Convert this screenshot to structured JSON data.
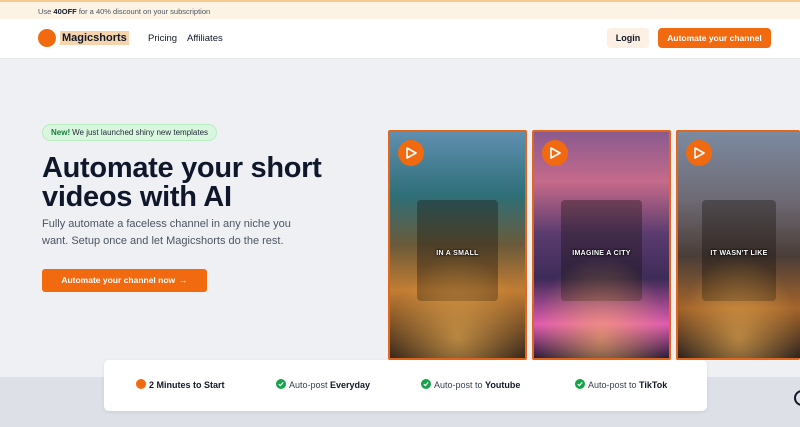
{
  "promo": {
    "prefix": "Use ",
    "code": "40OFF",
    "suffix": " for a 40% discount on your subscription"
  },
  "nav": {
    "brand": "Magicshorts",
    "links": [
      "Pricing",
      "Affiliates"
    ],
    "login": "Login",
    "cta": "Automate your channel"
  },
  "hero": {
    "badge_strong": "New!",
    "badge_text": "We just launched shiny new templates",
    "title": "Automate your short videos with AI",
    "subtitle": "Fully automate a faceless channel in any niche you want. Setup once and let Magicshorts do the rest.",
    "cta": "Automate your channel now",
    "cta_icon": "arrow-right-icon"
  },
  "videos": [
    {
      "caption": "IN A SMALL",
      "icon": "play-icon"
    },
    {
      "caption": "IMAGINE A CITY",
      "icon": "play-icon"
    },
    {
      "caption": "IT WASN'T LIKE",
      "icon": "play-icon"
    }
  ],
  "features": [
    {
      "strong": "2 Minutes to Start",
      "prefix": "",
      "icon": "clock-icon"
    },
    {
      "prefix": "Auto-post ",
      "strong": "Everyday",
      "icon": "check-circle-icon"
    },
    {
      "prefix": "Auto-post to ",
      "strong": "Youtube",
      "icon": "check-circle-icon"
    },
    {
      "prefix": "Auto-post to ",
      "strong": "TikTok",
      "icon": "check-circle-icon"
    }
  ],
  "colors": {
    "accent": "#f26a0f",
    "success": "#16a34a",
    "promo_bg": "#fdf3e4"
  }
}
